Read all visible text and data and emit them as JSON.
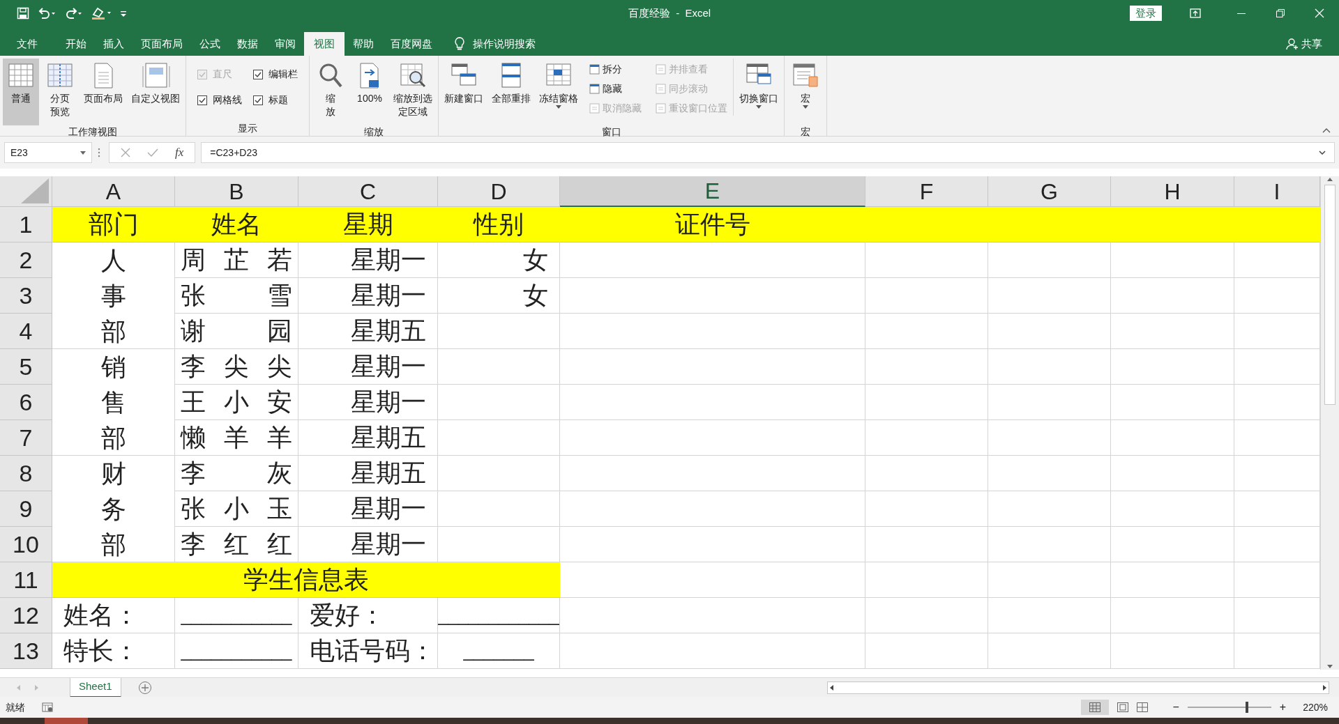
{
  "window": {
    "title": "百度经验  -  Excel",
    "login_button": "登录"
  },
  "ribbon_tabs": [
    {
      "label": "文件",
      "selected": false
    },
    {
      "label": "开始",
      "selected": false
    },
    {
      "label": "插入",
      "selected": false
    },
    {
      "label": "页面布局",
      "selected": false
    },
    {
      "label": "公式",
      "selected": false
    },
    {
      "label": "数据",
      "selected": false
    },
    {
      "label": "审阅",
      "selected": false
    },
    {
      "label": "视图",
      "selected": true
    },
    {
      "label": "帮助",
      "selected": false
    },
    {
      "label": "百度网盘",
      "selected": false
    }
  ],
  "tell_me": "操作说明搜索",
  "share": "共享",
  "ribbon_groups": [
    {
      "label": "工作簿视图",
      "items": [
        {
          "kind": "large",
          "label": "普通",
          "selected": true,
          "dropdown": false
        },
        {
          "kind": "stacked",
          "label": "分页预览",
          "selected": false,
          "dropdown": false
        },
        {
          "kind": "large",
          "label": "页面布局",
          "selected": false,
          "dropdown": false
        },
        {
          "kind": "large",
          "label": "自定义视图",
          "selected": false,
          "dropdown": false
        }
      ]
    },
    {
      "label": "显示",
      "items": [
        {
          "kind": "checkbox",
          "label": "直尺",
          "checked": true,
          "disabled": true
        },
        {
          "kind": "checkbox",
          "label": "编辑栏",
          "checked": true,
          "disabled": false
        },
        {
          "kind": "checkbox",
          "label": "网格线",
          "checked": true,
          "disabled": false
        },
        {
          "kind": "checkbox",
          "label": "标题",
          "checked": true,
          "disabled": false
        }
      ]
    },
    {
      "label": "缩放",
      "items": [
        {
          "kind": "stacked",
          "label": "缩放",
          "selected": false,
          "dropdown": false
        },
        {
          "kind": "large",
          "label": "100%",
          "selected": false,
          "dropdown": false
        },
        {
          "kind": "stacked",
          "label": "缩放到选定区域",
          "selected": false,
          "dropdown": false
        }
      ]
    },
    {
      "label": "窗口",
      "items": [
        {
          "kind": "large",
          "label": "新建窗口",
          "selected": false,
          "dropdown": false
        },
        {
          "kind": "large",
          "label": "全部重排",
          "selected": false,
          "dropdown": false
        },
        {
          "kind": "large",
          "label": "冻结窗格",
          "selected": false,
          "dropdown": true
        },
        {
          "kind": "small",
          "label": "拆分",
          "disabled": false
        },
        {
          "kind": "small",
          "label": "隐藏",
          "disabled": false
        },
        {
          "kind": "small",
          "label": "取消隐藏",
          "disabled": true
        },
        {
          "kind": "small",
          "label": "并排查看",
          "disabled": true
        },
        {
          "kind": "small",
          "label": "同步滚动",
          "disabled": true
        },
        {
          "kind": "small",
          "label": "重设窗口位置",
          "disabled": true
        },
        {
          "kind": "large",
          "label": "切换窗口",
          "selected": false,
          "dropdown": true
        }
      ]
    },
    {
      "label": "宏",
      "items": [
        {
          "kind": "large",
          "label": "宏",
          "selected": false,
          "dropdown": true
        }
      ]
    }
  ],
  "name_box": "E23",
  "function_button": "fx",
  "formula": "=C23+D23",
  "columns": [
    {
      "label": "A",
      "selected": false
    },
    {
      "label": "B",
      "selected": false
    },
    {
      "label": "C",
      "selected": false
    },
    {
      "label": "D",
      "selected": false
    },
    {
      "label": "E",
      "selected": true
    },
    {
      "label": "F",
      "selected": false
    },
    {
      "label": "G",
      "selected": false
    },
    {
      "label": "H",
      "selected": false
    },
    {
      "label": "I",
      "selected": false
    }
  ],
  "rows": [
    {
      "header": "1",
      "cells": [
        {
          "kind": "heading",
          "text": "部门",
          "highlight": true
        },
        {
          "kind": "heading",
          "text": "姓名",
          "highlight": true
        },
        {
          "kind": "heading",
          "text": "星期",
          "highlight": true
        },
        {
          "kind": "heading",
          "text": "性别",
          "highlight": true
        },
        {
          "kind": "heading",
          "text": "证件号",
          "highlight": true
        },
        {
          "kind": "empty",
          "highlight": true
        },
        {
          "kind": "empty",
          "highlight": true
        },
        {
          "kind": "empty",
          "highlight": true
        },
        {
          "kind": "empty",
          "highlight": true
        }
      ]
    },
    {
      "header": "2",
      "cells": [
        {
          "kind": "department",
          "text": "人事部",
          "highlight": false
        },
        {
          "kind": "name",
          "text": "周芷若",
          "highlight": false
        },
        {
          "kind": "weekday",
          "text": "星期一",
          "highlight": false
        },
        {
          "kind": "gender",
          "text": "女",
          "highlight": false
        },
        {
          "kind": "empty",
          "highlight": false
        },
        {
          "kind": "empty",
          "highlight": false
        },
        {
          "kind": "empty",
          "highlight": false
        },
        {
          "kind": "empty",
          "highlight": false
        },
        {
          "kind": "empty",
          "highlight": false
        }
      ]
    },
    {
      "header": "3",
      "cells": [
        {
          "kind": "name",
          "text": "张雪",
          "highlight": false
        },
        {
          "kind": "weekday",
          "text": "星期一",
          "highlight": false
        },
        {
          "kind": "gender",
          "text": "女",
          "highlight": false
        },
        {
          "kind": "empty",
          "highlight": false
        },
        {
          "kind": "empty",
          "highlight": false
        },
        {
          "kind": "empty",
          "highlight": false
        },
        {
          "kind": "empty",
          "highlight": false
        },
        {
          "kind": "empty",
          "highlight": false
        }
      ]
    },
    {
      "header": "4",
      "cells": [
        {
          "kind": "name",
          "text": "谢园",
          "highlight": false
        },
        {
          "kind": "weekday",
          "text": "星期五",
          "highlight": false
        },
        {
          "kind": "empty",
          "highlight": false
        },
        {
          "kind": "empty",
          "highlight": false
        },
        {
          "kind": "empty",
          "highlight": false
        },
        {
          "kind": "empty",
          "highlight": false
        },
        {
          "kind": "empty",
          "highlight": false
        },
        {
          "kind": "empty",
          "highlight": false
        }
      ]
    },
    {
      "header": "5",
      "cells": [
        {
          "kind": "department",
          "text": "销售部",
          "highlight": false
        },
        {
          "kind": "name",
          "text": "李尖尖",
          "highlight": false
        },
        {
          "kind": "weekday",
          "text": "星期一",
          "highlight": false
        },
        {
          "kind": "empty",
          "highlight": false
        },
        {
          "kind": "empty",
          "highlight": false
        },
        {
          "kind": "empty",
          "highlight": false
        },
        {
          "kind": "empty",
          "highlight": false
        },
        {
          "kind": "empty",
          "highlight": false
        },
        {
          "kind": "empty",
          "highlight": false
        }
      ]
    },
    {
      "header": "6",
      "cells": [
        {
          "kind": "name",
          "text": "王小安",
          "highlight": false
        },
        {
          "kind": "weekday",
          "text": "星期一",
          "highlight": false
        },
        {
          "kind": "empty",
          "highlight": false
        },
        {
          "kind": "empty",
          "highlight": false
        },
        {
          "kind": "empty",
          "highlight": false
        },
        {
          "kind": "empty",
          "highlight": false
        },
        {
          "kind": "empty",
          "highlight": false
        },
        {
          "kind": "empty",
          "highlight": false
        }
      ]
    },
    {
      "header": "7",
      "cells": [
        {
          "kind": "name",
          "text": "懒羊羊",
          "highlight": false
        },
        {
          "kind": "weekday",
          "text": "星期五",
          "highlight": false
        },
        {
          "kind": "empty",
          "highlight": false
        },
        {
          "kind": "empty",
          "highlight": false
        },
        {
          "kind": "empty",
          "highlight": false
        },
        {
          "kind": "empty",
          "highlight": false
        },
        {
          "kind": "empty",
          "highlight": false
        },
        {
          "kind": "empty",
          "highlight": false
        }
      ]
    },
    {
      "header": "8",
      "cells": [
        {
          "kind": "department",
          "text": "财务部",
          "highlight": false
        },
        {
          "kind": "name",
          "text": "李灰",
          "highlight": false
        },
        {
          "kind": "weekday",
          "text": "星期五",
          "highlight": false
        },
        {
          "kind": "empty",
          "highlight": false
        },
        {
          "kind": "empty",
          "highlight": false
        },
        {
          "kind": "empty",
          "highlight": false
        },
        {
          "kind": "empty",
          "highlight": false
        },
        {
          "kind": "empty",
          "highlight": false
        },
        {
          "kind": "empty",
          "highlight": false
        }
      ]
    },
    {
      "header": "9",
      "cells": [
        {
          "kind": "name",
          "text": "张小玉",
          "highlight": false
        },
        {
          "kind": "weekday",
          "text": "星期一",
          "highlight": false
        },
        {
          "kind": "empty",
          "highlight": false
        },
        {
          "kind": "empty",
          "highlight": false
        },
        {
          "kind": "empty",
          "highlight": false
        },
        {
          "kind": "empty",
          "highlight": false
        },
        {
          "kind": "empty",
          "highlight": false
        },
        {
          "kind": "empty",
          "highlight": false
        }
      ]
    },
    {
      "header": "10",
      "cells": [
        {
          "kind": "name",
          "text": "李红红",
          "highlight": false
        },
        {
          "kind": "weekday",
          "text": "星期一",
          "highlight": false
        },
        {
          "kind": "empty",
          "highlight": false
        },
        {
          "kind": "empty",
          "highlight": false
        },
        {
          "kind": "empty",
          "highlight": false
        },
        {
          "kind": "empty",
          "highlight": false
        },
        {
          "kind": "empty",
          "highlight": false
        },
        {
          "kind": "empty",
          "highlight": false
        }
      ]
    },
    {
      "header": "11",
      "cells": [
        {
          "kind": "title",
          "text": "学生信息表",
          "highlight": true
        },
        {
          "kind": "empty",
          "highlight": false
        },
        {
          "kind": "empty",
          "highlight": false
        },
        {
          "kind": "empty",
          "highlight": false
        },
        {
          "kind": "empty",
          "highlight": false
        },
        {
          "kind": "empty",
          "highlight": false
        }
      ]
    },
    {
      "header": "12",
      "cells": [
        {
          "kind": "label",
          "text": "姓名：",
          "highlight": false
        },
        {
          "kind": "blank",
          "text": "___________",
          "highlight": false
        },
        {
          "kind": "label",
          "text": "爱好：",
          "highlight": false
        },
        {
          "kind": "blank",
          "text": "____________",
          "highlight": false
        },
        {
          "kind": "empty",
          "highlight": false
        },
        {
          "kind": "empty",
          "highlight": false
        },
        {
          "kind": "empty",
          "highlight": false
        },
        {
          "kind": "empty",
          "highlight": false
        },
        {
          "kind": "empty",
          "highlight": false
        }
      ]
    },
    {
      "header": "13",
      "cells": [
        {
          "kind": "label",
          "text": "特长：",
          "highlight": false
        },
        {
          "kind": "blank",
          "text": "___________",
          "highlight": false
        },
        {
          "kind": "label",
          "text": "电话号码：",
          "highlight": false
        },
        {
          "kind": "blank",
          "text": "_______",
          "highlight": false
        },
        {
          "kind": "empty",
          "highlight": false
        },
        {
          "kind": "empty",
          "highlight": false
        },
        {
          "kind": "empty",
          "highlight": false
        },
        {
          "kind": "empty",
          "highlight": false
        },
        {
          "kind": "empty",
          "highlight": false
        }
      ]
    }
  ],
  "sheet_tabs": [
    {
      "label": "Sheet1",
      "selected": true
    }
  ],
  "status_bar": {
    "status": "就绪",
    "zoom_out": "−",
    "zoom_in": "+",
    "zoom": {
      "reading": "220%",
      "level": 0.69
    }
  }
}
